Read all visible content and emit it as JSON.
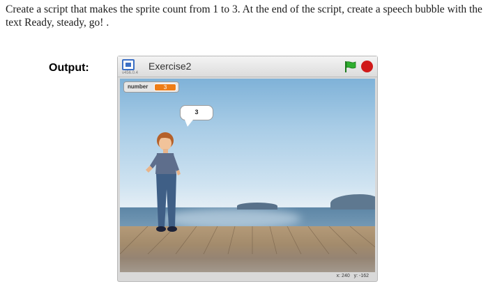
{
  "instructions": {
    "text": "Create a script that makes the sprite count from 1 to 3. At the end of the script, create a speech bubble with the text  Ready, steady, go! ."
  },
  "output_label": "Output:",
  "player": {
    "project_title": "Exercise2",
    "version": "v456.0.4",
    "variable_monitor": {
      "name": "number",
      "value": "3"
    },
    "speech_bubble": {
      "text": "3"
    },
    "coordinates": {
      "x_label": "x:",
      "x_value": "240",
      "y_label": "y:",
      "y_value": "-162"
    },
    "icons": {
      "fullscreen": "fullscreen-icon",
      "green_flag": "green-flag-icon",
      "stop": "stop-icon",
      "sprite": "boy-sprite"
    },
    "colors": {
      "green_flag": "#2fae2f",
      "stop": "#d01a1a",
      "variable_value_bg": "#ee7d16"
    }
  }
}
